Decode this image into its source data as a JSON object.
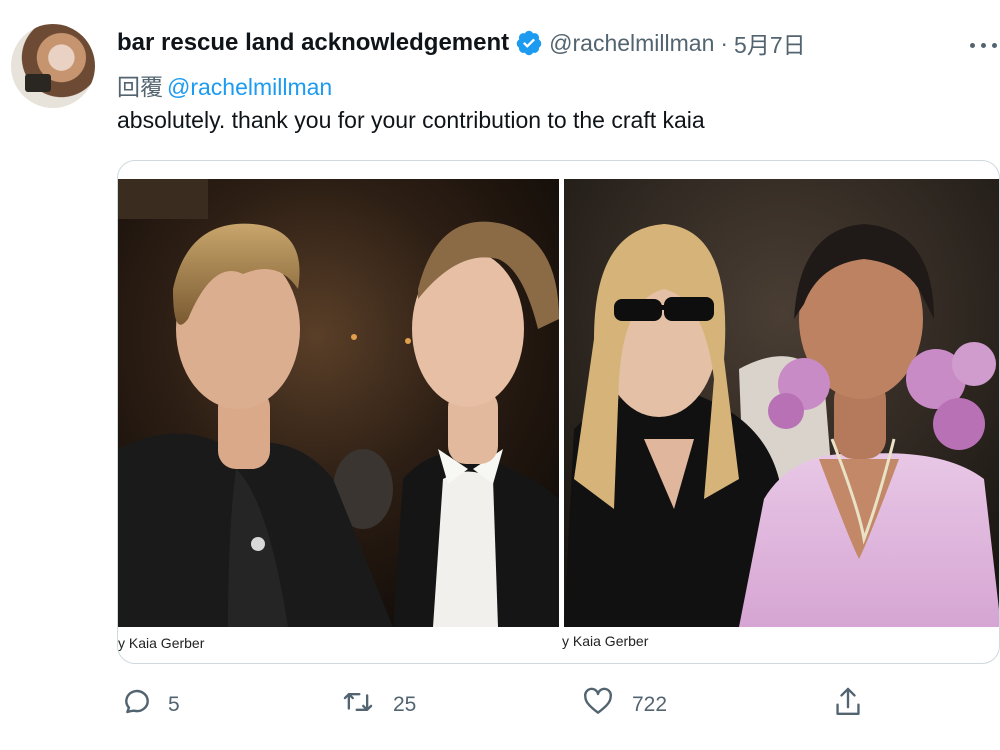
{
  "tweet": {
    "display_name": "bar rescue land acknowledgement",
    "handle": "@rachelmillman",
    "separator": "·",
    "date": "5月7日",
    "reply_prefix": "回覆",
    "reply_to": "@rachelmillman",
    "text": "absolutely. thank you for your contribution to the craft kaia"
  },
  "media": {
    "left_credit": "y Kaia Gerber",
    "right_credit": "y Kaia Gerber"
  },
  "actions": {
    "replies": "5",
    "retweets": "25",
    "likes": "722"
  },
  "icons": {
    "verified": "verified-badge-icon",
    "more": "more-options-icon",
    "reply": "reply-icon",
    "retweet": "retweet-icon",
    "like": "heart-icon",
    "share": "share-icon"
  },
  "colors": {
    "accent": "#1d9bf0",
    "secondary_text": "#536471",
    "primary_text": "#0f1419"
  }
}
